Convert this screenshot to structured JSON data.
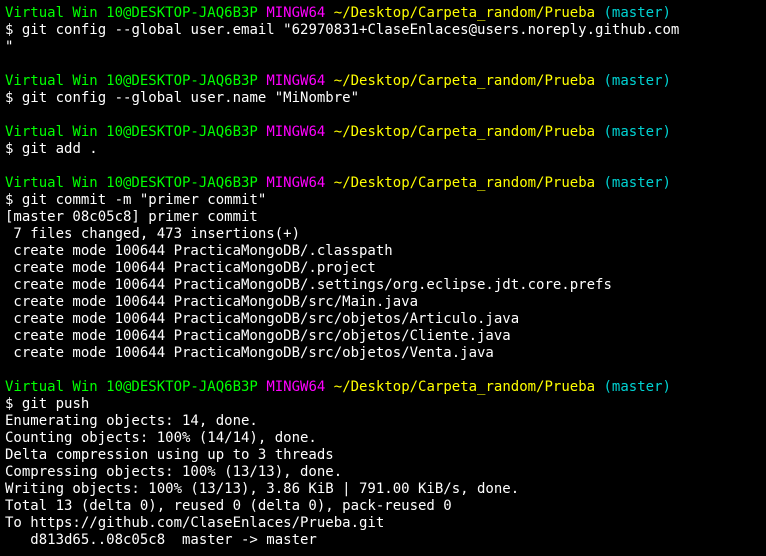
{
  "prompt": {
    "user_host": "Virtual Win 10@DESKTOP-JAQ6B3P",
    "shell": "MINGW64",
    "path": "~/Desktop/Carpeta_random/Prueba",
    "branch": "(master)",
    "symbol": "$"
  },
  "colors": {
    "background": "#000000",
    "user_host": "#00ff00",
    "shell": "#ff00ff",
    "path": "#ffff00",
    "branch": "#00d2d2",
    "text": "#ffffff"
  },
  "blocks": [
    {
      "command": "git config --global user.email \"62970831+ClaseEnlaces@users.noreply.github.com",
      "output": [
        "\""
      ]
    },
    {
      "command": "git config --global user.name \"MiNombre\"",
      "output": []
    },
    {
      "command": "git add .",
      "output": []
    },
    {
      "command": "git commit -m \"primer commit\"",
      "output": [
        "[master 08c05c8] primer commit",
        " 7 files changed, 473 insertions(+)",
        " create mode 100644 PracticaMongoDB/.classpath",
        " create mode 100644 PracticaMongoDB/.project",
        " create mode 100644 PracticaMongoDB/.settings/org.eclipse.jdt.core.prefs",
        " create mode 100644 PracticaMongoDB/src/Main.java",
        " create mode 100644 PracticaMongoDB/src/objetos/Articulo.java",
        " create mode 100644 PracticaMongoDB/src/objetos/Cliente.java",
        " create mode 100644 PracticaMongoDB/src/objetos/Venta.java"
      ]
    },
    {
      "command": "git push",
      "output": [
        "Enumerating objects: 14, done.",
        "Counting objects: 100% (14/14), done.",
        "Delta compression using up to 3 threads",
        "Compressing objects: 100% (13/13), done.",
        "Writing objects: 100% (13/13), 3.86 KiB | 791.00 KiB/s, done.",
        "Total 13 (delta 0), reused 0 (delta 0), pack-reused 0",
        "To https://github.com/ClaseEnlaces/Prueba.git",
        "   d813d65..08c05c8  master -> master"
      ]
    }
  ]
}
